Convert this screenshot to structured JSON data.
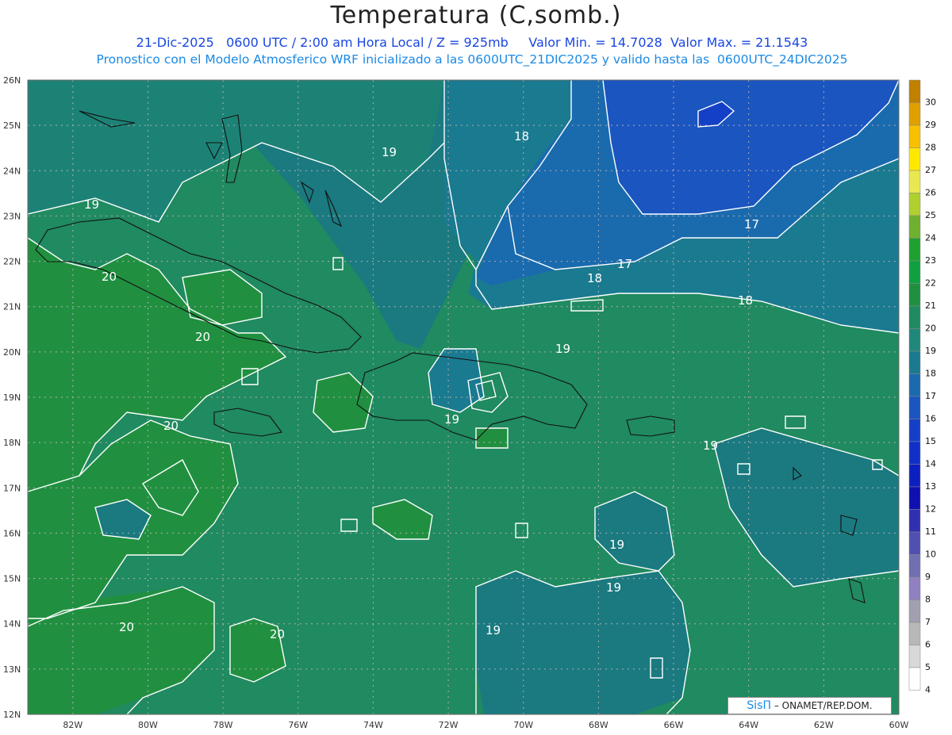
{
  "header": {
    "title": "Temperatura (C,somb.)",
    "subtitle_1": "21-Dic-2025   0600 UTC / 2:00 am Hora Local / Z = 925mb     Valor Min. = 14.7028  Valor Max. = 21.1543",
    "subtitle_2": "Pronostico con el Modelo Atmosferico WRF inicializado a las 0600UTC_21DIC2025 y valido hasta las  0600UTC_24DIC2025"
  },
  "axes": {
    "lat_labels": [
      "26N",
      "25N",
      "24N",
      "23N",
      "22N",
      "21N",
      "20N",
      "19N",
      "18N",
      "17N",
      "16N",
      "15N",
      "14N",
      "13N",
      "12N"
    ],
    "lon_labels": [
      "82W",
      "80W",
      "78W",
      "76W",
      "74W",
      "72W",
      "70W",
      "68W",
      "66W",
      "64W",
      "62W",
      "60W"
    ],
    "lat_range": [
      12,
      26
    ],
    "lon_range": [
      -83.2,
      -60
    ]
  },
  "colorbar": {
    "levels": [
      "30",
      "29",
      "28",
      "27",
      "26",
      "25",
      "24",
      "23",
      "22",
      "21",
      "20",
      "19",
      "18",
      "17",
      "16",
      "15",
      "14",
      "13",
      "12",
      "11",
      "10",
      "9",
      "8",
      "7",
      "6",
      "5",
      "4"
    ],
    "colors": [
      "#c08000",
      "#e0a000",
      "#f8c000",
      "#ffe800",
      "#e8e850",
      "#b0d030",
      "#70b030",
      "#20a030",
      "#10a040",
      "#209040",
      "#208a60",
      "#20887a",
      "#1a7a90",
      "#1a6aae",
      "#1a55c0",
      "#1440c8",
      "#1030c8",
      "#0c20c0",
      "#1010b0",
      "#3030b0",
      "#5050b0",
      "#7070b0",
      "#9080c0",
      "#a0a0b0",
      "#b8b8b8",
      "#d8d8d8",
      "#ffffff"
    ]
  },
  "contours": [
    {
      "label": "18",
      "value": 18
    },
    {
      "label": "19",
      "value": 19
    },
    {
      "label": "17",
      "value": 17
    },
    {
      "label": "20",
      "value": 20
    }
  ],
  "credit": {
    "brand": "SisΠ",
    "org": "– ONAMET/REP.DOM."
  }
}
